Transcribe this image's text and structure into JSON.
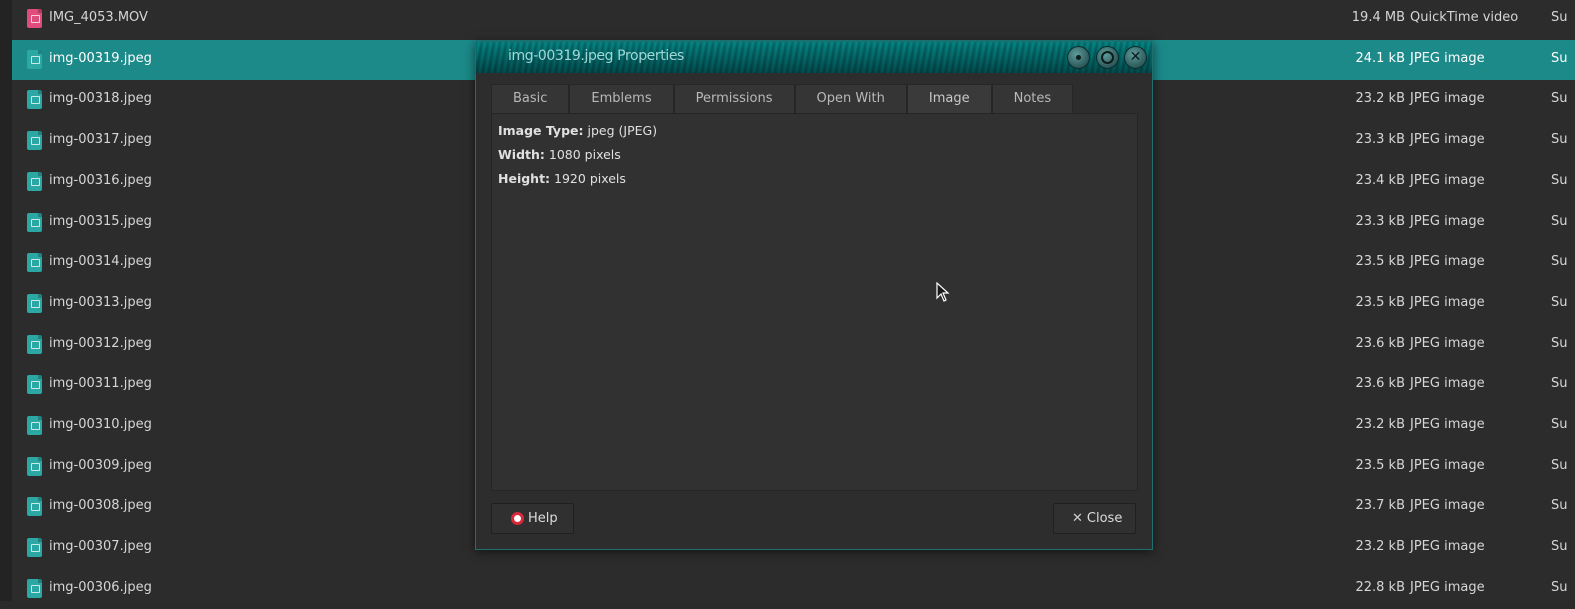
{
  "files": [
    {
      "name": "IMG_4053.MOV",
      "size": "19.4 MB",
      "type": "QuickTime video",
      "extra": "Su",
      "icon": "video-file-icon"
    },
    {
      "name": "img-00319.jpeg",
      "size": "24.1 kB",
      "type": "JPEG image",
      "extra": "Su",
      "icon": "image-file-icon",
      "selected": true
    },
    {
      "name": "img-00318.jpeg",
      "size": "23.2 kB",
      "type": "JPEG image",
      "extra": "Su",
      "icon": "image-file-icon"
    },
    {
      "name": "img-00317.jpeg",
      "size": "23.3 kB",
      "type": "JPEG image",
      "extra": "Su",
      "icon": "image-file-icon"
    },
    {
      "name": "img-00316.jpeg",
      "size": "23.4 kB",
      "type": "JPEG image",
      "extra": "Su",
      "icon": "image-file-icon"
    },
    {
      "name": "img-00315.jpeg",
      "size": "23.3 kB",
      "type": "JPEG image",
      "extra": "Su",
      "icon": "image-file-icon"
    },
    {
      "name": "img-00314.jpeg",
      "size": "23.5 kB",
      "type": "JPEG image",
      "extra": "Su",
      "icon": "image-file-icon"
    },
    {
      "name": "img-00313.jpeg",
      "size": "23.5 kB",
      "type": "JPEG image",
      "extra": "Su",
      "icon": "image-file-icon"
    },
    {
      "name": "img-00312.jpeg",
      "size": "23.6 kB",
      "type": "JPEG image",
      "extra": "Su",
      "icon": "image-file-icon"
    },
    {
      "name": "img-00311.jpeg",
      "size": "23.6 kB",
      "type": "JPEG image",
      "extra": "Su",
      "icon": "image-file-icon"
    },
    {
      "name": "img-00310.jpeg",
      "size": "23.2 kB",
      "type": "JPEG image",
      "extra": "Su",
      "icon": "image-file-icon"
    },
    {
      "name": "img-00309.jpeg",
      "size": "23.5 kB",
      "type": "JPEG image",
      "extra": "Su",
      "icon": "image-file-icon"
    },
    {
      "name": "img-00308.jpeg",
      "size": "23.7 kB",
      "type": "JPEG image",
      "extra": "Su",
      "icon": "image-file-icon"
    },
    {
      "name": "img-00307.jpeg",
      "size": "23.2 kB",
      "type": "JPEG image",
      "extra": "Su",
      "icon": "image-file-icon"
    },
    {
      "name": "img-00306.jpeg",
      "size": "22.8 kB",
      "type": "JPEG image",
      "extra": "Su",
      "icon": "image-file-icon"
    }
  ],
  "dialog": {
    "title": "img-00319.jpeg Properties",
    "tabs": [
      "Basic",
      "Emblems",
      "Permissions",
      "Open With",
      "Image",
      "Notes"
    ],
    "active_tab": "Image",
    "image_type_label": "Image Type:",
    "image_type_value": "jpeg (JPEG)",
    "width_label": "Width:",
    "width_value": "1080 pixels",
    "height_label": "Height:",
    "height_value": "1920 pixels",
    "help_label": "Help",
    "close_label": "Close"
  },
  "colors": {
    "selection": "#1b8a89",
    "image_icon": "#2ba8a3",
    "video_icon": "#e04d7c"
  }
}
